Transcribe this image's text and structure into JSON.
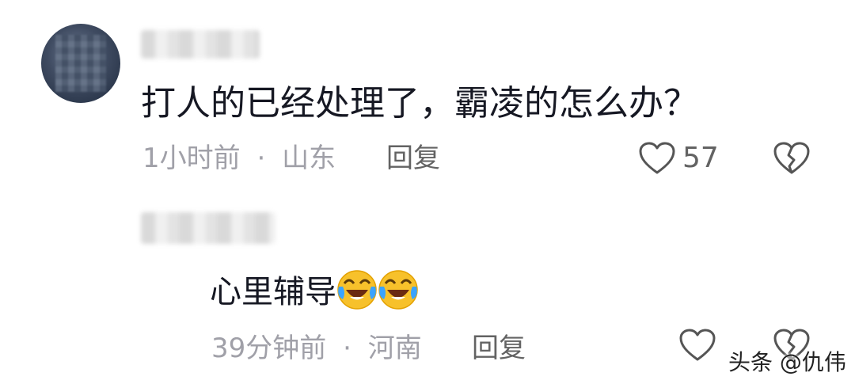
{
  "comment": {
    "text": "打人的已经处理了，霸凌的怎么办？",
    "time": "1小时前",
    "separator": "·",
    "location": "山东",
    "reply_label": "回复",
    "likes": "57"
  },
  "reply": {
    "text": "心里辅导",
    "emoji": [
      "laugh-cry-emoji",
      "laugh-cry-emoji"
    ],
    "time": "39分钟前",
    "separator": "·",
    "location": "河南",
    "reply_label": "回复"
  },
  "watermark": "头条 @仇伟",
  "colors": {
    "text": "#161823",
    "meta": "#a0a0a8",
    "action": "#636363"
  }
}
